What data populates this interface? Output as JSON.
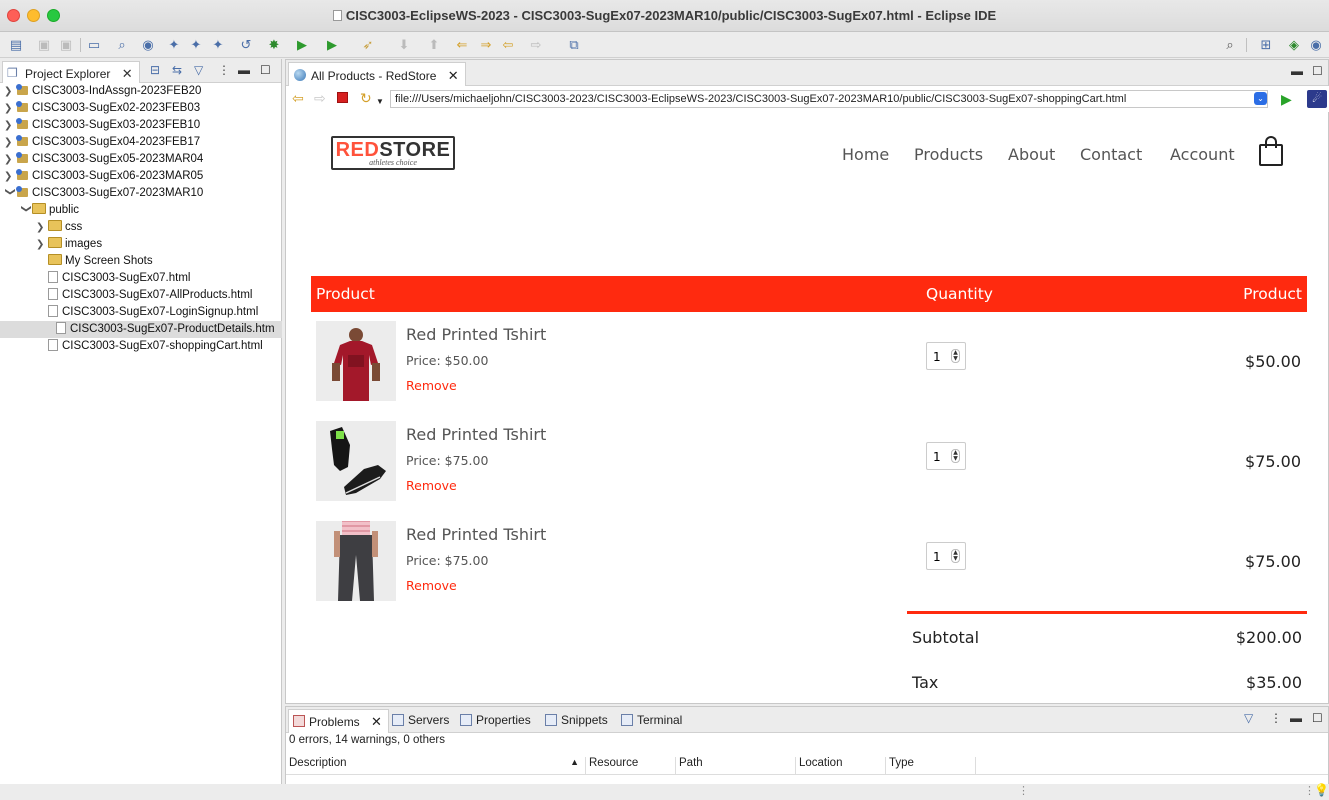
{
  "window": {
    "title": "CISC3003-EclipseWS-2023 - CISC3003-SugEx07-2023MAR10/public/CISC3003-SugEx07.html - Eclipse IDE"
  },
  "project_explorer": {
    "tab_label": "Project Explorer",
    "projects": [
      {
        "label": "CISC3003-IndAssgn-2023FEB20"
      },
      {
        "label": "CISC3003-SugEx02-2023FEB03"
      },
      {
        "label": "CISC3003-SugEx03-2023FEB10"
      },
      {
        "label": "CISC3003-SugEx04-2023FEB17"
      },
      {
        "label": "CISC3003-SugEx05-2023MAR04"
      },
      {
        "label": "CISC3003-SugEx06-2023MAR05"
      },
      {
        "label": "CISC3003-SugEx07-2023MAR10"
      }
    ],
    "folders": [
      {
        "label": "public"
      },
      {
        "label": "css"
      },
      {
        "label": "images"
      },
      {
        "label": "My Screen Shots"
      }
    ],
    "files": [
      {
        "label": "CISC3003-SugEx07.html"
      },
      {
        "label": "CISC3003-SugEx07-AllProducts.html"
      },
      {
        "label": "CISC3003-SugEx07-LoginSignup.html"
      },
      {
        "label": "CISC3003-SugEx07-ProductDetails.htm"
      },
      {
        "label": "CISC3003-SugEx07-shoppingCart.html"
      }
    ]
  },
  "editor": {
    "tab_label": "All Products - RedStore",
    "url": "file:///Users/michaeljohn/CISC3003-2023/CISC3003-EclipseWS-2023/CISC3003-SugEx07-2023MAR10/public/CISC3003-SugEx07-shoppingCart.html"
  },
  "site": {
    "logo_prefix": "RED",
    "logo_suffix": "STORE",
    "logo_tagline": "athletes choice",
    "nav": [
      "Home",
      "Products",
      "About",
      "Contact",
      "Account"
    ],
    "accent_color": "#ff2a0f"
  },
  "cart": {
    "headers": {
      "product": "Product",
      "quantity": "Quantity",
      "subtotal": "Product"
    },
    "items": [
      {
        "name": "Red Printed Tshirt",
        "price": "Price: $50.00",
        "remove": "Remove",
        "qty": "1",
        "total": "$50.00",
        "image": "red-tshirt-image"
      },
      {
        "name": "Red Printed Tshirt",
        "price": "Price: $75.00",
        "remove": "Remove",
        "qty": "1",
        "total": "$75.00",
        "image": "black-shoes-image"
      },
      {
        "name": "Red Printed Tshirt",
        "price": "Price: $75.00",
        "remove": "Remove",
        "qty": "1",
        "total": "$75.00",
        "image": "grey-pants-image"
      }
    ],
    "summary": [
      {
        "label": "Subtotal",
        "value": "$200.00"
      },
      {
        "label": "Tax",
        "value": "$35.00"
      }
    ]
  },
  "bottom_panel": {
    "tabs": [
      "Problems",
      "Servers",
      "Properties",
      "Snippets",
      "Terminal"
    ],
    "status": "0 errors, 14 warnings, 0 others",
    "columns": [
      "Description",
      "Resource",
      "Path",
      "Location",
      "Type"
    ]
  }
}
